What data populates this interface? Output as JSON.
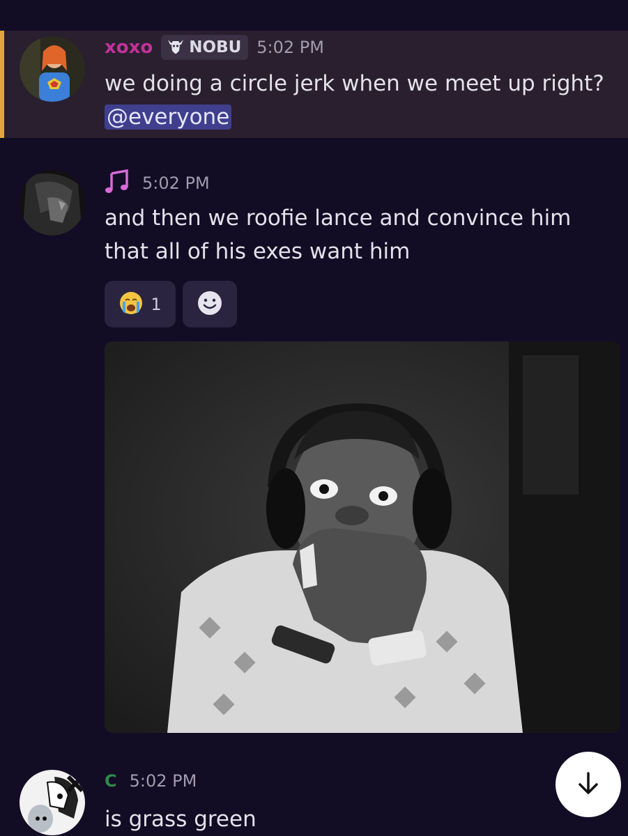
{
  "messages": [
    {
      "username": "xoxo",
      "username_color": "#c0339a",
      "tag": {
        "icon": "goat-skull-icon",
        "label": "NOBU"
      },
      "time": "5:02 PM",
      "text": "we doing a circle jerk when we meet up right?",
      "mention": "@everyone",
      "highlighted": true,
      "highlight_color": "#e0a83a"
    },
    {
      "username_icon": "music-note-icon",
      "username_color": "#d86ad8",
      "time": "5:02 PM",
      "text_lines": [
        "and then we roofie lance and convince him",
        "that all of his exes want him"
      ],
      "reactions": [
        {
          "emoji": "loudly-crying-face-icon",
          "count": "1"
        }
      ],
      "add_reaction_icon": "add-reaction-smiley-icon",
      "attachment": {
        "type": "image",
        "description": "shocked-man-with-headphones-gif"
      }
    },
    {
      "username": "C",
      "username_color": "#2f8a4a",
      "time": "5:02 PM",
      "text": "is grass green"
    }
  ],
  "scroll_button": {
    "icon": "arrow-down-icon"
  }
}
